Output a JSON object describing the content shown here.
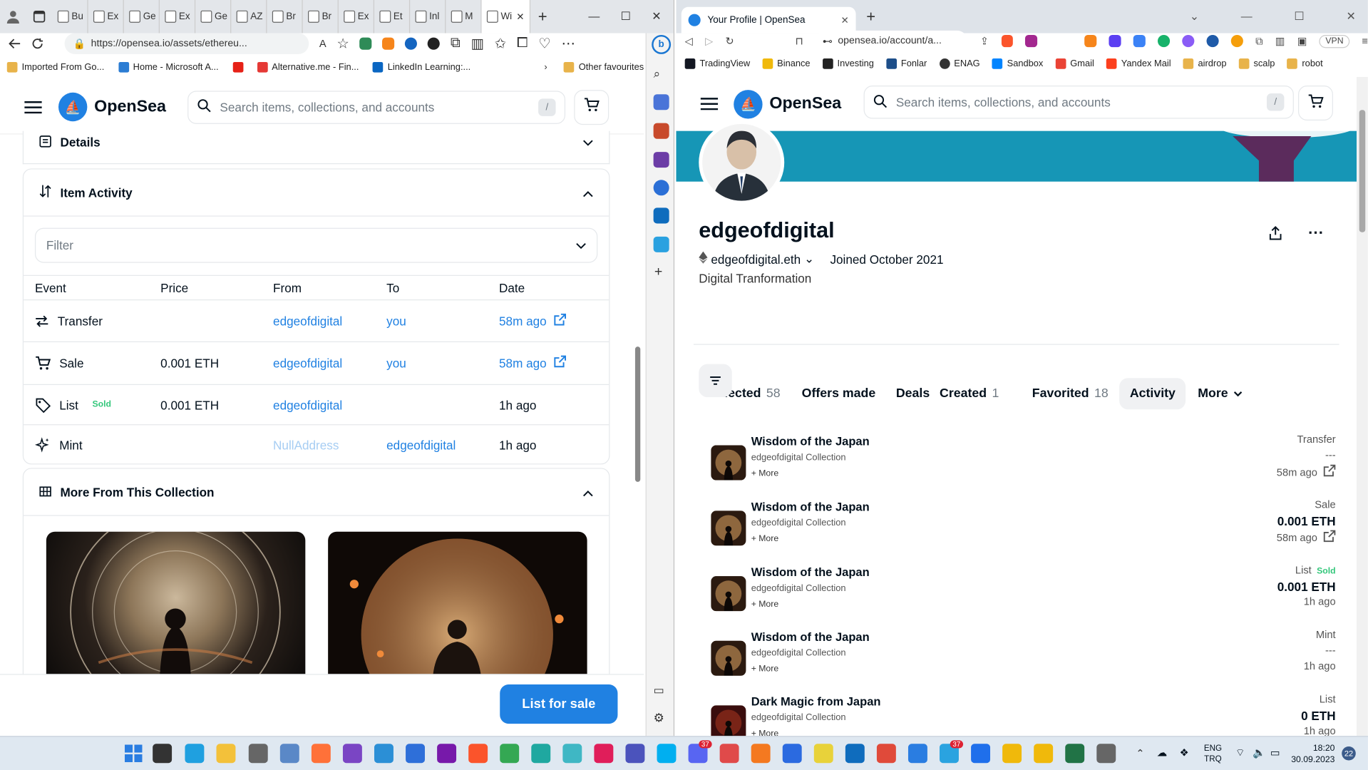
{
  "left_window": {
    "tabs": [
      "Bu",
      "Ex",
      "Ge",
      "Ex",
      "Ge",
      "AZ",
      "Br",
      "Br",
      "Ex",
      "Et",
      "Inl",
      "M",
      "Wi"
    ],
    "url": "https://opensea.io/assets/ethereu...",
    "bookmarks": [
      "Imported From Go...",
      "Home - Microsoft A...",
      "Alternative.me - Fin...",
      "LinkedIn Learning:..."
    ],
    "other_favourites": "Other favourites",
    "search_placeholder": "Search items, collections, and accounts",
    "search_key": "/",
    "logo": "OpenSea",
    "details_label": "Details",
    "item_activity_label": "Item Activity",
    "filter_placeholder": "Filter",
    "columns": [
      "Event",
      "Price",
      "From",
      "To",
      "Date"
    ],
    "rows": [
      {
        "event": "Transfer",
        "price": "",
        "from": "edgeofdigital",
        "to": "you",
        "date": "58m ago",
        "icon": "transfer-icon"
      },
      {
        "event": "Sale",
        "price": "0.001 ETH",
        "from": "edgeofdigital",
        "to": "you",
        "date": "58m ago",
        "icon": "cart-icon"
      },
      {
        "event": "List",
        "badge": "Sold",
        "price": "0.001 ETH",
        "from": "edgeofdigital",
        "to": "",
        "date": "1h ago",
        "icon": "tag-icon"
      },
      {
        "event": "Mint",
        "price": "",
        "from": "NullAddress",
        "to": "edgeofdigital",
        "date": "1h ago",
        "icon": "sparkle-icon"
      }
    ],
    "more_from_collection": "More From This Collection",
    "list_for_sale": "List for sale"
  },
  "right_window": {
    "tab_title": "Your Profile | OpenSea",
    "url": "opensea.io/account/a...",
    "bookmarks": [
      "TradingView",
      "Binance",
      "Investing",
      "Fonlar",
      "ENAG",
      "Sandbox",
      "Gmail",
      "Yandex Mail",
      "airdrop",
      "scalp",
      "robot"
    ],
    "vpn": "VPN",
    "logo": "OpenSea",
    "search_placeholder": "Search items, collections, and accounts",
    "search_key": "/",
    "username": "edgeofdigital",
    "ens": "edgeofdigital.eth",
    "joined": "Joined October 2021",
    "bio": "Digital Tranformation",
    "tabs": [
      {
        "label": "Collected",
        "count": "58"
      },
      {
        "label": "Offers made",
        "count": ""
      },
      {
        "label": "Deals",
        "count": ""
      },
      {
        "label": "Created",
        "count": "1"
      },
      {
        "label": "Favorited",
        "count": "18"
      },
      {
        "label": "Activity",
        "count": ""
      },
      {
        "label": "More",
        "count": ""
      }
    ],
    "activity": [
      {
        "name": "Wisdom of the Japan",
        "collection": "edgeofdigital Collection",
        "more": "+ More",
        "event": "Transfer",
        "badge": "",
        "price": "---",
        "time": "58m ago"
      },
      {
        "name": "Wisdom of the Japan",
        "collection": "edgeofdigital Collection",
        "more": "+ More",
        "event": "Sale",
        "badge": "",
        "price": "0.001 ETH",
        "time": "58m ago"
      },
      {
        "name": "Wisdom of the Japan",
        "collection": "edgeofdigital Collection",
        "more": "+ More",
        "event": "List",
        "badge": "Sold",
        "price": "0.001 ETH",
        "time": "1h ago"
      },
      {
        "name": "Wisdom of the Japan",
        "collection": "edgeofdigital Collection",
        "more": "+ More",
        "event": "Mint",
        "badge": "",
        "price": "---",
        "time": "1h ago"
      },
      {
        "name": "Dark Magic from Japan",
        "collection": "edgeofdigital Collection",
        "more": "+ More",
        "event": "List",
        "badge": "",
        "price": "0 ETH",
        "time": "1h ago"
      }
    ]
  },
  "taskbar": {
    "lang_top": "ENG",
    "lang_bottom": "TRQ",
    "time": "18:20",
    "date": "30.09.2023",
    "badge_count": "22",
    "chat_badge": "37",
    "discord_badge": "37"
  },
  "colors": {
    "accent": "#2081e2",
    "sold": "#34c77b",
    "banner": "#1696b6"
  }
}
